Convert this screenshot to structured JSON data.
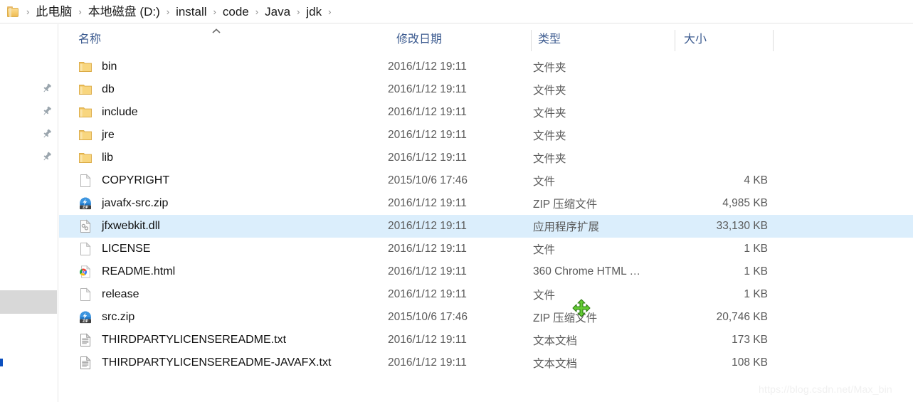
{
  "window": {
    "app": "Windows File Explorer",
    "watermark": "https://blog.csdn.net/Max_bin"
  },
  "addressbar": {
    "folder_icon": "folder-icon",
    "separator": "›",
    "crumbs": [
      {
        "label": "此电脑"
      },
      {
        "label": "本地磁盘 (D:)"
      },
      {
        "label": "install"
      },
      {
        "label": "code"
      },
      {
        "label": "Java"
      },
      {
        "label": "jdk"
      }
    ]
  },
  "navpane": {
    "pins": [
      {
        "icon": "pin-icon"
      },
      {
        "icon": "pin-icon"
      },
      {
        "icon": "pin-icon"
      },
      {
        "icon": "pin-icon"
      }
    ]
  },
  "filelist": {
    "columns": [
      {
        "key": "name",
        "label": "名称",
        "sorted": "asc",
        "sort_icon": "chevron-up-icon"
      },
      {
        "key": "date",
        "label": "修改日期"
      },
      {
        "key": "type",
        "label": "类型"
      },
      {
        "key": "size",
        "label": "大小"
      }
    ],
    "rows": [
      {
        "name": "bin",
        "date": "2016/1/12 19:11",
        "type": "文件夹",
        "size": "",
        "icon": "folder-icon",
        "selected": false
      },
      {
        "name": "db",
        "date": "2016/1/12 19:11",
        "type": "文件夹",
        "size": "",
        "icon": "folder-icon",
        "selected": false
      },
      {
        "name": "include",
        "date": "2016/1/12 19:11",
        "type": "文件夹",
        "size": "",
        "icon": "folder-icon",
        "selected": false
      },
      {
        "name": "jre",
        "date": "2016/1/12 19:11",
        "type": "文件夹",
        "size": "",
        "icon": "folder-icon",
        "selected": false
      },
      {
        "name": "lib",
        "date": "2016/1/12 19:11",
        "type": "文件夹",
        "size": "",
        "icon": "folder-icon",
        "selected": false
      },
      {
        "name": "COPYRIGHT",
        "date": "2015/10/6 17:46",
        "type": "文件",
        "size": "4 KB",
        "icon": "blank-file-icon",
        "selected": false
      },
      {
        "name": "javafx-src.zip",
        "date": "2016/1/12 19:11",
        "type": "ZIP 压缩文件",
        "size": "4,985 KB",
        "icon": "zip-icon",
        "selected": false
      },
      {
        "name": "jfxwebkit.dll",
        "date": "2016/1/12 19:11",
        "type": "应用程序扩展",
        "size": "33,130 KB",
        "icon": "dll-icon",
        "selected": true
      },
      {
        "name": "LICENSE",
        "date": "2016/1/12 19:11",
        "type": "文件",
        "size": "1 KB",
        "icon": "blank-file-icon",
        "selected": false
      },
      {
        "name": "README.html",
        "date": "2016/1/12 19:11",
        "type": "360 Chrome HTML …",
        "size": "1 KB",
        "icon": "chrome360-html-icon",
        "selected": false
      },
      {
        "name": "release",
        "date": "2016/1/12 19:11",
        "type": "文件",
        "size": "1 KB",
        "icon": "blank-file-icon",
        "selected": false
      },
      {
        "name": "src.zip",
        "date": "2015/10/6 17:46",
        "type": "ZIP 压缩文件",
        "size": "20,746 KB",
        "icon": "zip-icon",
        "selected": false
      },
      {
        "name": "THIRDPARTYLICENSEREADME.txt",
        "date": "2016/1/12 19:11",
        "type": "文本文档",
        "size": "173 KB",
        "icon": "text-file-icon",
        "selected": false
      },
      {
        "name": "THIRDPARTYLICENSEREADME-JAVAFX.txt",
        "date": "2016/1/12 19:11",
        "type": "文本文档",
        "size": "108 KB",
        "icon": "text-file-icon",
        "selected": false
      }
    ]
  },
  "cursor": {
    "icon": "move-cursor-icon",
    "color": "#5ccc32"
  },
  "colors": {
    "selection": "#dbeefc",
    "header_text": "#3b5a8f",
    "body_text": "#111111",
    "secondary_text": "#5a5a5a",
    "folder_yellow": "#f6cb6d",
    "divider": "#dcdcdc"
  }
}
